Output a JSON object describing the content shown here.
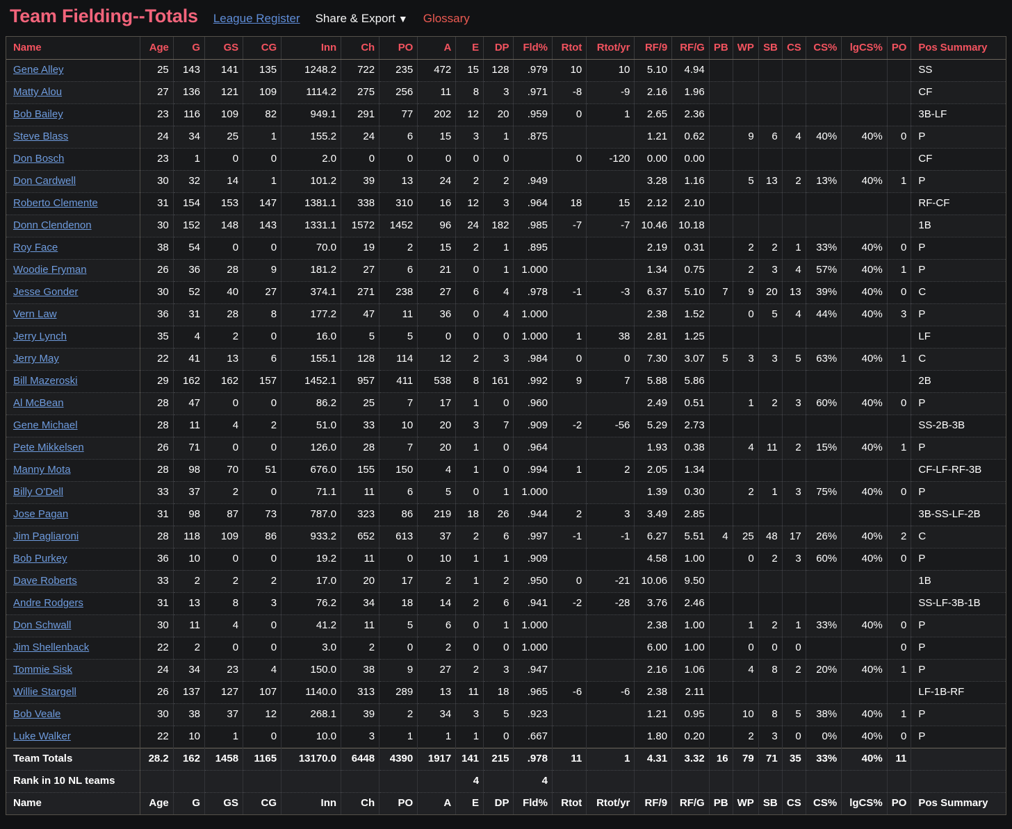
{
  "header": {
    "title": "Team Fielding--Totals",
    "league_register_label": "League Register",
    "share_export_label": "Share & Export",
    "share_export_caret": "▼",
    "glossary_label": "Glossary"
  },
  "table": {
    "columns": [
      "Name",
      "Age",
      "G",
      "GS",
      "CG",
      "Inn",
      "Ch",
      "PO",
      "A",
      "E",
      "DP",
      "Fld%",
      "Rtot",
      "Rtot/yr",
      "RF/9",
      "RF/G",
      "PB",
      "WP",
      "SB",
      "CS",
      "CS%",
      "lgCS%",
      "PO",
      "Pos Summary"
    ],
    "rows": [
      [
        "Gene Alley",
        "25",
        "143",
        "141",
        "135",
        "1248.2",
        "722",
        "235",
        "472",
        "15",
        "128",
        ".979",
        "10",
        "10",
        "5.10",
        "4.94",
        "",
        "",
        "",
        "",
        "",
        "",
        "",
        "SS"
      ],
      [
        "Matty Alou",
        "27",
        "136",
        "121",
        "109",
        "1114.2",
        "275",
        "256",
        "11",
        "8",
        "3",
        ".971",
        "-8",
        "-9",
        "2.16",
        "1.96",
        "",
        "",
        "",
        "",
        "",
        "",
        "",
        "CF"
      ],
      [
        "Bob Bailey",
        "23",
        "116",
        "109",
        "82",
        "949.1",
        "291",
        "77",
        "202",
        "12",
        "20",
        ".959",
        "0",
        "1",
        "2.65",
        "2.36",
        "",
        "",
        "",
        "",
        "",
        "",
        "",
        "3B-LF"
      ],
      [
        "Steve Blass",
        "24",
        "34",
        "25",
        "1",
        "155.2",
        "24",
        "6",
        "15",
        "3",
        "1",
        ".875",
        "",
        "",
        "1.21",
        "0.62",
        "",
        "9",
        "6",
        "4",
        "40%",
        "40%",
        "0",
        "P"
      ],
      [
        "Don Bosch",
        "23",
        "1",
        "0",
        "0",
        "2.0",
        "0",
        "0",
        "0",
        "0",
        "0",
        "",
        "0",
        "-120",
        "0.00",
        "0.00",
        "",
        "",
        "",
        "",
        "",
        "",
        "",
        "CF"
      ],
      [
        "Don Cardwell",
        "30",
        "32",
        "14",
        "1",
        "101.2",
        "39",
        "13",
        "24",
        "2",
        "2",
        ".949",
        "",
        "",
        "3.28",
        "1.16",
        "",
        "5",
        "13",
        "2",
        "13%",
        "40%",
        "1",
        "P"
      ],
      [
        "Roberto Clemente",
        "31",
        "154",
        "153",
        "147",
        "1381.1",
        "338",
        "310",
        "16",
        "12",
        "3",
        ".964",
        "18",
        "15",
        "2.12",
        "2.10",
        "",
        "",
        "",
        "",
        "",
        "",
        "",
        "RF-CF"
      ],
      [
        "Donn Clendenon",
        "30",
        "152",
        "148",
        "143",
        "1331.1",
        "1572",
        "1452",
        "96",
        "24",
        "182",
        ".985",
        "-7",
        "-7",
        "10.46",
        "10.18",
        "",
        "",
        "",
        "",
        "",
        "",
        "",
        "1B"
      ],
      [
        "Roy Face",
        "38",
        "54",
        "0",
        "0",
        "70.0",
        "19",
        "2",
        "15",
        "2",
        "1",
        ".895",
        "",
        "",
        "2.19",
        "0.31",
        "",
        "2",
        "2",
        "1",
        "33%",
        "40%",
        "0",
        "P"
      ],
      [
        "Woodie Fryman",
        "26",
        "36",
        "28",
        "9",
        "181.2",
        "27",
        "6",
        "21",
        "0",
        "1",
        "1.000",
        "",
        "",
        "1.34",
        "0.75",
        "",
        "2",
        "3",
        "4",
        "57%",
        "40%",
        "1",
        "P"
      ],
      [
        "Jesse Gonder",
        "30",
        "52",
        "40",
        "27",
        "374.1",
        "271",
        "238",
        "27",
        "6",
        "4",
        ".978",
        "-1",
        "-3",
        "6.37",
        "5.10",
        "7",
        "9",
        "20",
        "13",
        "39%",
        "40%",
        "0",
        "C"
      ],
      [
        "Vern Law",
        "36",
        "31",
        "28",
        "8",
        "177.2",
        "47",
        "11",
        "36",
        "0",
        "4",
        "1.000",
        "",
        "",
        "2.38",
        "1.52",
        "",
        "0",
        "5",
        "4",
        "44%",
        "40%",
        "3",
        "P"
      ],
      [
        "Jerry Lynch",
        "35",
        "4",
        "2",
        "0",
        "16.0",
        "5",
        "5",
        "0",
        "0",
        "0",
        "1.000",
        "1",
        "38",
        "2.81",
        "1.25",
        "",
        "",
        "",
        "",
        "",
        "",
        "",
        "LF"
      ],
      [
        "Jerry May",
        "22",
        "41",
        "13",
        "6",
        "155.1",
        "128",
        "114",
        "12",
        "2",
        "3",
        ".984",
        "0",
        "0",
        "7.30",
        "3.07",
        "5",
        "3",
        "3",
        "5",
        "63%",
        "40%",
        "1",
        "C"
      ],
      [
        "Bill Mazeroski",
        "29",
        "162",
        "162",
        "157",
        "1452.1",
        "957",
        "411",
        "538",
        "8",
        "161",
        ".992",
        "9",
        "7",
        "5.88",
        "5.86",
        "",
        "",
        "",
        "",
        "",
        "",
        "",
        "2B"
      ],
      [
        "Al McBean",
        "28",
        "47",
        "0",
        "0",
        "86.2",
        "25",
        "7",
        "17",
        "1",
        "0",
        ".960",
        "",
        "",
        "2.49",
        "0.51",
        "",
        "1",
        "2",
        "3",
        "60%",
        "40%",
        "0",
        "P"
      ],
      [
        "Gene Michael",
        "28",
        "11",
        "4",
        "2",
        "51.0",
        "33",
        "10",
        "20",
        "3",
        "7",
        ".909",
        "-2",
        "-56",
        "5.29",
        "2.73",
        "",
        "",
        "",
        "",
        "",
        "",
        "",
        "SS-2B-3B"
      ],
      [
        "Pete Mikkelsen",
        "26",
        "71",
        "0",
        "0",
        "126.0",
        "28",
        "7",
        "20",
        "1",
        "0",
        ".964",
        "",
        "",
        "1.93",
        "0.38",
        "",
        "4",
        "11",
        "2",
        "15%",
        "40%",
        "1",
        "P"
      ],
      [
        "Manny Mota",
        "28",
        "98",
        "70",
        "51",
        "676.0",
        "155",
        "150",
        "4",
        "1",
        "0",
        ".994",
        "1",
        "2",
        "2.05",
        "1.34",
        "",
        "",
        "",
        "",
        "",
        "",
        "",
        "CF-LF-RF-3B"
      ],
      [
        "Billy O'Dell",
        "33",
        "37",
        "2",
        "0",
        "71.1",
        "11",
        "6",
        "5",
        "0",
        "1",
        "1.000",
        "",
        "",
        "1.39",
        "0.30",
        "",
        "2",
        "1",
        "3",
        "75%",
        "40%",
        "0",
        "P"
      ],
      [
        "Jose Pagan",
        "31",
        "98",
        "87",
        "73",
        "787.0",
        "323",
        "86",
        "219",
        "18",
        "26",
        ".944",
        "2",
        "3",
        "3.49",
        "2.85",
        "",
        "",
        "",
        "",
        "",
        "",
        "",
        "3B-SS-LF-2B"
      ],
      [
        "Jim Pagliaroni",
        "28",
        "118",
        "109",
        "86",
        "933.2",
        "652",
        "613",
        "37",
        "2",
        "6",
        ".997",
        "-1",
        "-1",
        "6.27",
        "5.51",
        "4",
        "25",
        "48",
        "17",
        "26%",
        "40%",
        "2",
        "C"
      ],
      [
        "Bob Purkey",
        "36",
        "10",
        "0",
        "0",
        "19.2",
        "11",
        "0",
        "10",
        "1",
        "1",
        ".909",
        "",
        "",
        "4.58",
        "1.00",
        "",
        "0",
        "2",
        "3",
        "60%",
        "40%",
        "0",
        "P"
      ],
      [
        "Dave Roberts",
        "33",
        "2",
        "2",
        "2",
        "17.0",
        "20",
        "17",
        "2",
        "1",
        "2",
        ".950",
        "0",
        "-21",
        "10.06",
        "9.50",
        "",
        "",
        "",
        "",
        "",
        "",
        "",
        "1B"
      ],
      [
        "Andre Rodgers",
        "31",
        "13",
        "8",
        "3",
        "76.2",
        "34",
        "18",
        "14",
        "2",
        "6",
        ".941",
        "-2",
        "-28",
        "3.76",
        "2.46",
        "",
        "",
        "",
        "",
        "",
        "",
        "",
        "SS-LF-3B-1B"
      ],
      [
        "Don Schwall",
        "30",
        "11",
        "4",
        "0",
        "41.2",
        "11",
        "5",
        "6",
        "0",
        "1",
        "1.000",
        "",
        "",
        "2.38",
        "1.00",
        "",
        "1",
        "2",
        "1",
        "33%",
        "40%",
        "0",
        "P"
      ],
      [
        "Jim Shellenback",
        "22",
        "2",
        "0",
        "0",
        "3.0",
        "2",
        "0",
        "2",
        "0",
        "0",
        "1.000",
        "",
        "",
        "6.00",
        "1.00",
        "",
        "0",
        "0",
        "0",
        "",
        "",
        "0",
        "P"
      ],
      [
        "Tommie Sisk",
        "24",
        "34",
        "23",
        "4",
        "150.0",
        "38",
        "9",
        "27",
        "2",
        "3",
        ".947",
        "",
        "",
        "2.16",
        "1.06",
        "",
        "4",
        "8",
        "2",
        "20%",
        "40%",
        "1",
        "P"
      ],
      [
        "Willie Stargell",
        "26",
        "137",
        "127",
        "107",
        "1140.0",
        "313",
        "289",
        "13",
        "11",
        "18",
        ".965",
        "-6",
        "-6",
        "2.38",
        "2.11",
        "",
        "",
        "",
        "",
        "",
        "",
        "",
        "LF-1B-RF"
      ],
      [
        "Bob Veale",
        "30",
        "38",
        "37",
        "12",
        "268.1",
        "39",
        "2",
        "34",
        "3",
        "5",
        ".923",
        "",
        "",
        "1.21",
        "0.95",
        "",
        "10",
        "8",
        "5",
        "38%",
        "40%",
        "1",
        "P"
      ],
      [
        "Luke Walker",
        "22",
        "10",
        "1",
        "0",
        "10.0",
        "3",
        "1",
        "1",
        "1",
        "0",
        ".667",
        "",
        "",
        "1.80",
        "0.20",
        "",
        "2",
        "3",
        "0",
        "0%",
        "40%",
        "0",
        "P"
      ]
    ],
    "footer_rows": [
      [
        "Team Totals",
        "28.2",
        "162",
        "1458",
        "1165",
        "13170.0",
        "6448",
        "4390",
        "1917",
        "141",
        "215",
        ".978",
        "11",
        "1",
        "4.31",
        "3.32",
        "16",
        "79",
        "71",
        "35",
        "33%",
        "40%",
        "11",
        ""
      ],
      [
        "Rank in 10 NL teams",
        "",
        "",
        "",
        "",
        "",
        "",
        "",
        "",
        "4",
        "",
        "4",
        "",
        "",
        "",
        "",
        "",
        "",
        "",
        "",
        "",
        "",
        "",
        ""
      ],
      [
        "Name",
        "Age",
        "G",
        "GS",
        "CG",
        "Inn",
        "Ch",
        "PO",
        "A",
        "E",
        "DP",
        "Fld%",
        "Rtot",
        "Rtot/yr",
        "RF/9",
        "RF/G",
        "PB",
        "WP",
        "SB",
        "CS",
        "CS%",
        "lgCS%",
        "PO",
        "Pos Summary"
      ]
    ]
  },
  "colors": {
    "background": "#111214",
    "title": "#f2647b",
    "header_text": "#f2535f",
    "link": "#6e9bdd",
    "glossary": "#ec5a52",
    "value_text": "#ffffff"
  }
}
